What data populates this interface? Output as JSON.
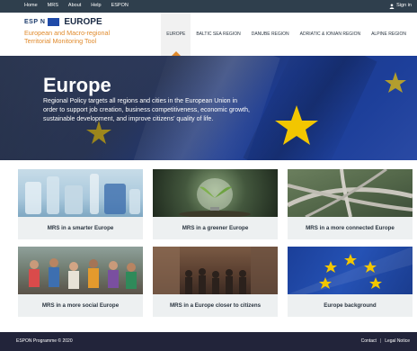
{
  "topbar": {
    "links": [
      "Home",
      "MRS",
      "About",
      "Help",
      "ESPON"
    ],
    "signin": "Sign in"
  },
  "header": {
    "espon_word": "ESP N",
    "title": "EUROPE",
    "subtitle_line1": "European and Macro-regional",
    "subtitle_line2": "Territorial Monitoring Tool"
  },
  "regions": [
    {
      "label": "EUROPE",
      "active": true
    },
    {
      "label": "BALTIC SEA REGION",
      "active": false
    },
    {
      "label": "DANUBE REGION",
      "active": false
    },
    {
      "label": "ADRIATIC & IONIAN REGION",
      "active": false
    },
    {
      "label": "ALPINE REGION",
      "active": false
    }
  ],
  "hero": {
    "title": "Europe",
    "text": "Regional Policy targets all regions and cities in the European Union in order to support job creation, business competitiveness, economic growth, sustainable development, and improve citizens' quality of life."
  },
  "tiles": [
    {
      "label": "MRS in a smarter Europe",
      "icon": "lab-glassware-image"
    },
    {
      "label": "MRS in a greener Europe",
      "icon": "lightbulb-plant-image"
    },
    {
      "label": "MRS in a more connected Europe",
      "icon": "highway-interchange-image"
    },
    {
      "label": "MRS in a more social Europe",
      "icon": "people-group-image"
    },
    {
      "label": "MRS in a Europe closer to citizens",
      "icon": "street-crowd-image"
    },
    {
      "label": "Europe background",
      "icon": "eu-flag-image"
    }
  ],
  "footer": {
    "copyright": "ESPON Programme © 2020",
    "contact": "Contact",
    "separator": "|",
    "legal": "Legal Notice"
  },
  "colors": {
    "topbar": "#2f3f4d",
    "accent": "#e08a2c",
    "footer": "#22243a",
    "tile_bg": "#edf0f1",
    "eu_blue": "#1f4aa8"
  }
}
